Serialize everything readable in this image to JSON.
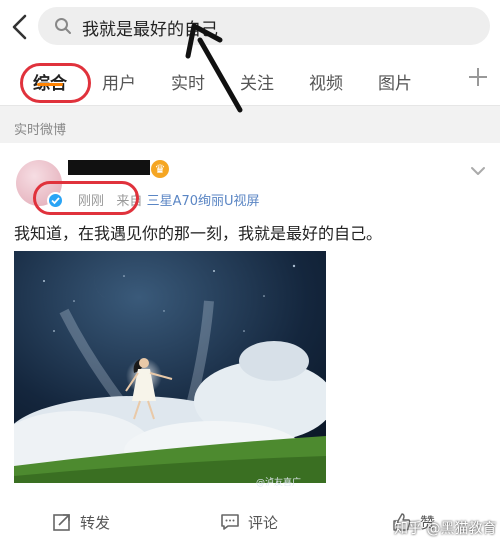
{
  "search": {
    "query": "我就是最好的自己"
  },
  "tabs": [
    {
      "label": "综合",
      "active": true
    },
    {
      "label": "用户"
    },
    {
      "label": "实时"
    },
    {
      "label": "关注"
    },
    {
      "label": "视频"
    },
    {
      "label": "图片"
    }
  ],
  "section": {
    "label": "实时微博"
  },
  "post": {
    "time": "刚刚",
    "from_prefix": "来自",
    "source": "三星A70绚丽U视屏",
    "text": "我知道，在我遇见你的那一刻，我就是最好的自己。",
    "image_watermark": "@泸友喜广"
  },
  "actions": {
    "repost": "转发",
    "comment": "评论",
    "like": "赞"
  },
  "bottom_watermark": "知乎 @黑猫教育",
  "colors": {
    "accent": "#ff8200",
    "annotation": "#e0323c",
    "link": "#5b86c4",
    "verified": "#2aa4f5"
  }
}
